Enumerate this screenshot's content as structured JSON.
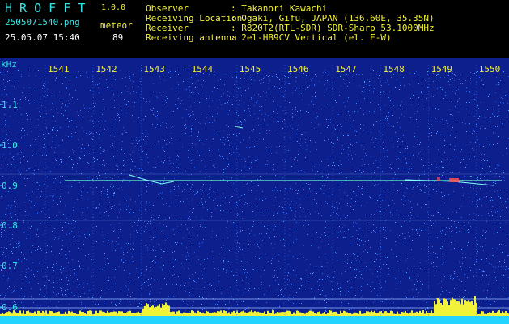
{
  "app": {
    "logo": "H R O F F T",
    "version": "1.0.0",
    "filename": "2505071540.png",
    "datetime": "25.05.07 15:40",
    "mode_label": "meteor",
    "count": "89"
  },
  "info": {
    "rows": [
      {
        "label": "Observer",
        "value": ": Takanori Kawachi"
      },
      {
        "label": "Receiving Location",
        "value": ": Ogaki, Gifu, JAPAN (136.60E, 35.35N)"
      },
      {
        "label": "Receiver",
        "value": ": R820T2(RTL-SDR) SDR-Sharp 53.1000MHz"
      },
      {
        "label": "Receiving antenna",
        "value": ": 2el-HB9CV Vertical (el. E-W)"
      }
    ]
  },
  "axes": {
    "y_unit": "kHz",
    "y_ticks": [
      "1.1",
      "1.0",
      "0.9",
      "0.8",
      "0.7",
      "0.6"
    ],
    "x_ticks": [
      "1541",
      "1542",
      "1543",
      "1544",
      "1545",
      "1546",
      "1547",
      "1548",
      "1549",
      "1550"
    ]
  },
  "colors": {
    "background": "#0c1f8c",
    "noise": "#2f6cff",
    "trace": "#66ffcc",
    "hot": "#ff4f4f",
    "meter": "#f2f23a",
    "meter_base": "#22d4ff",
    "text_yellow": "#f2f23a",
    "text_cyan": "#35e6e6"
  }
}
